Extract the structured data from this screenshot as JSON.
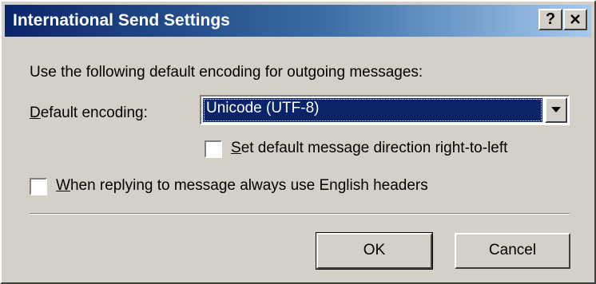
{
  "window": {
    "title": "International Send Settings",
    "help_label": "?",
    "close_label": "✕"
  },
  "intro_text": "Use the following default encoding for outgoing messages:",
  "encoding": {
    "label_accel": "D",
    "label_rest": "efault encoding:",
    "selected_value": "Unicode (UTF-8)",
    "arrow_icon": "dropdown-arrow-icon"
  },
  "checkboxes": {
    "rtl": {
      "checked": false,
      "label_accel": "S",
      "label_rest": "et default message direction right-to-left"
    },
    "english_headers": {
      "checked": false,
      "label_accel": "W",
      "label_rest": "hen replying to message always use English headers"
    }
  },
  "buttons": {
    "ok": "OK",
    "cancel": "Cancel"
  },
  "colors": {
    "titlebar_start": "#0a246a",
    "titlebar_end": "#a6caf0",
    "dialog_face": "#d4d0c8",
    "selection": "#0a246a"
  }
}
